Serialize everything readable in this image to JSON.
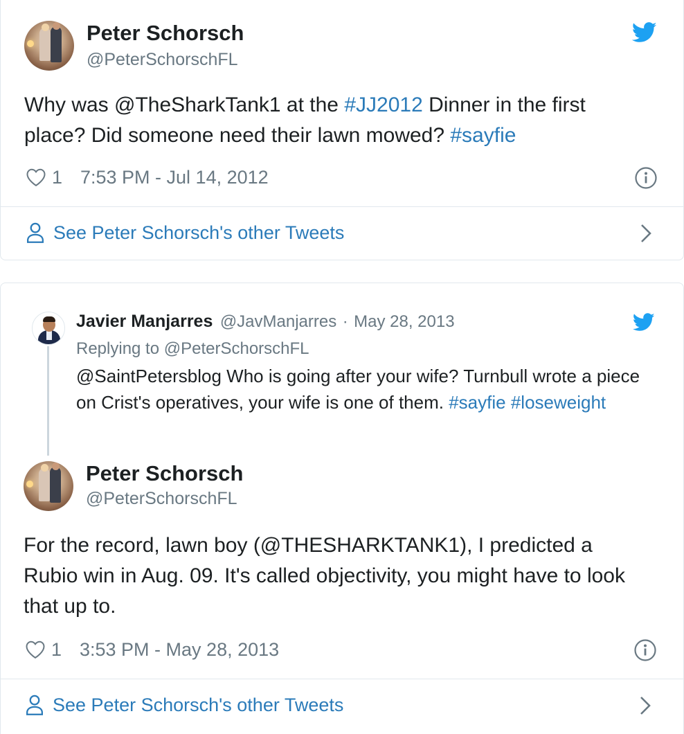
{
  "tweet1": {
    "author_name": "Peter Schorsch",
    "author_handle": "@PeterSchorschFL",
    "text_parts": [
      {
        "t": "Why was @TheSharkTank1 at the ",
        "link": false
      },
      {
        "t": "#JJ2012",
        "link": true
      },
      {
        "t": " Dinner in the first place? Did someone need their lawn mowed? ",
        "link": false
      },
      {
        "t": "#sayfie",
        "link": true
      }
    ],
    "likes": "1",
    "timestamp": "7:53 PM - Jul 14, 2012",
    "see_more": "See Peter Schorsch's other Tweets"
  },
  "reply": {
    "author_name": "Javier Manjarres",
    "author_handle": "@JavManjarres",
    "separator": "·",
    "date": "May 28, 2013",
    "replying_label": "Replying to",
    "replying_handle": "@PeterSchorschFL",
    "text_parts": [
      {
        "t": "@SaintPetersblog Who is going after your wife? Turnbull wrote a piece on Crist's operatives, your wife is one of them. ",
        "link": false
      },
      {
        "t": "#sayfie",
        "link": true
      },
      {
        "t": " ",
        "link": false
      },
      {
        "t": "#loseweight",
        "link": true
      }
    ]
  },
  "tweet2": {
    "author_name": "Peter Schorsch",
    "author_handle": "@PeterSchorschFL",
    "text": "For the record, lawn boy (@THESHARKTANK1), I predicted a Rubio win in Aug. 09. It's called objectivity, you might have to look that up to.",
    "likes": "1",
    "timestamp": "3:53 PM - May 28, 2013",
    "see_more": "See Peter Schorsch's other Tweets"
  },
  "colors": {
    "twitter_blue": "#1da1f2",
    "link_blue": "#2b7bb9",
    "text": "#1c2022",
    "muted": "#697882",
    "border": "#e1e8ed"
  },
  "icons": [
    "twitter-bird-icon",
    "heart-icon",
    "info-icon",
    "person-icon",
    "chevron-right-icon"
  ]
}
